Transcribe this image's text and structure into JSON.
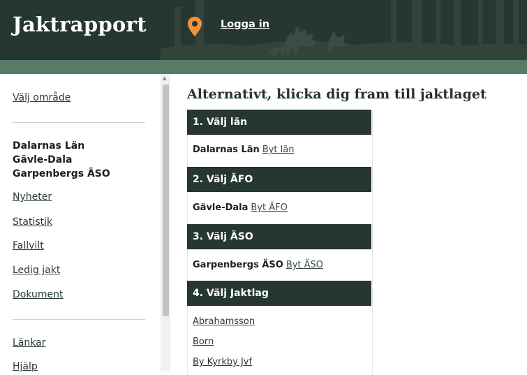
{
  "header": {
    "brand": "Jaktrapport",
    "login_label": "Logga in",
    "pin_icon": "location-pin-icon",
    "pin_color": "#f3923a",
    "bg_color": "#263630"
  },
  "sidebar": {
    "choose_area": "Välj område",
    "location": [
      "Dalarnas Län",
      "Gävle-Dala",
      "Garpenbergs ÄSO"
    ],
    "nav": [
      "Nyheter",
      "Statistik",
      "Fallvilt",
      "Ledig jakt",
      "Dokument"
    ],
    "extra": [
      "Länkar",
      "Hjälp"
    ]
  },
  "main": {
    "title": "Alternativt, klicka dig fram till jaktlaget",
    "steps": [
      {
        "heading": "1. Välj län",
        "value": "Dalarnas Län",
        "change": "Byt län"
      },
      {
        "heading": "2. Välj ÄFO",
        "value": "Gävle-Dala",
        "change": "Byt ÄFO"
      },
      {
        "heading": "3. Välj ÄSO",
        "value": "Garpenbergs ÄSO",
        "change": "Byt ÄSO"
      },
      {
        "heading": "4. Välj Jaktlag"
      }
    ],
    "hunting_teams": [
      "Abrahamsson",
      "Born",
      "By Kyrkby Jvf"
    ]
  }
}
